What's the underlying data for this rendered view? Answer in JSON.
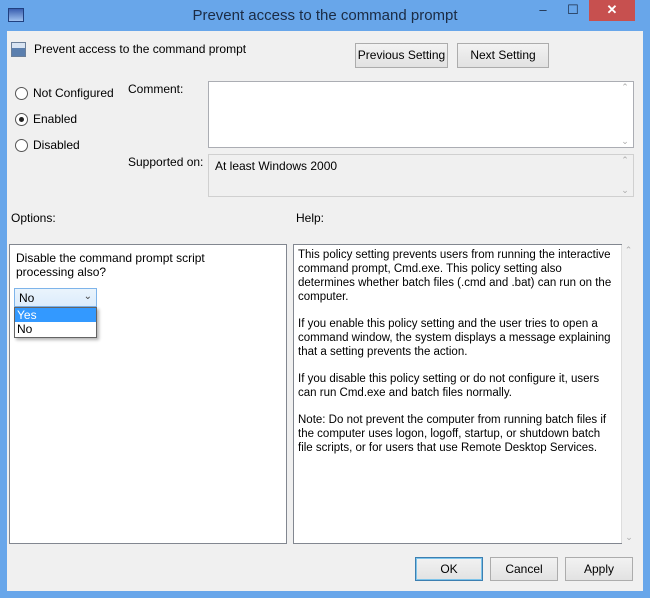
{
  "window": {
    "title": "Prevent access to the command prompt",
    "minimize": "–",
    "maximize": "☐",
    "close": "✕"
  },
  "header": {
    "policy_name": "Prevent access to the command prompt",
    "previous": "Previous Setting",
    "next": "Next Setting"
  },
  "state": {
    "options": [
      {
        "label": "Not Configured",
        "selected": false
      },
      {
        "label": "Enabled",
        "selected": true
      },
      {
        "label": "Disabled",
        "selected": false
      }
    ]
  },
  "comment": {
    "label": "Comment:",
    "value": ""
  },
  "supported": {
    "label": "Supported on:",
    "value": "At least Windows 2000"
  },
  "options_label": "Options:",
  "help_label": "Help:",
  "option": {
    "question": "Disable the command prompt script processing also?",
    "selected": "No",
    "choices": [
      "Yes",
      "No"
    ],
    "highlighted": "Yes"
  },
  "help": [
    "This policy setting prevents users from running the interactive command prompt, Cmd.exe.  This policy setting also determines whether batch files (.cmd and .bat) can run on the computer.",
    "If you enable this policy setting and the user tries to open a command window, the system displays a message explaining that a setting prevents the action.",
    "If you disable this policy setting or do not configure it, users can run Cmd.exe and batch files normally.",
    "Note: Do not prevent the computer from running batch files if the computer uses logon, logoff, startup, or shutdown batch file scripts, or for users that use Remote Desktop Services."
  ],
  "footer": {
    "ok": "OK",
    "cancel": "Cancel",
    "apply": "Apply"
  }
}
